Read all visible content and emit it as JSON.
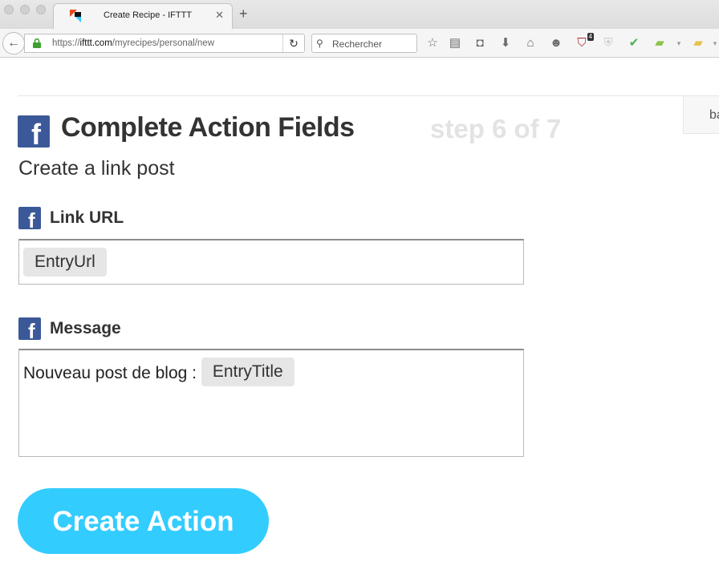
{
  "browser": {
    "tab_title": "Create Recipe - IFTTT",
    "tab_close": "✕",
    "new_tab": "+",
    "url_prefix": "https://",
    "url_domain": "ifttt.com",
    "url_path": "/myrecipes/personal/new",
    "search_placeholder": "Rechercher",
    "ublock_badge": "4"
  },
  "page": {
    "title": "Complete Action Fields",
    "step": "step 6 of 7",
    "subtitle": "Create a link post",
    "side_tab_label": "ba",
    "channel_icon": "f",
    "fields": [
      {
        "label": "Link URL",
        "ingredient": "EntryUrl"
      },
      {
        "label": "Message",
        "prefix_text": "Nouveau post de blog : ",
        "ingredient": "EntryTitle"
      }
    ],
    "submit_label": "Create Action"
  },
  "colors": {
    "facebook_blue": "#3b5998",
    "button_cyan": "#33ccff",
    "step_gray": "#e3e3e3"
  }
}
